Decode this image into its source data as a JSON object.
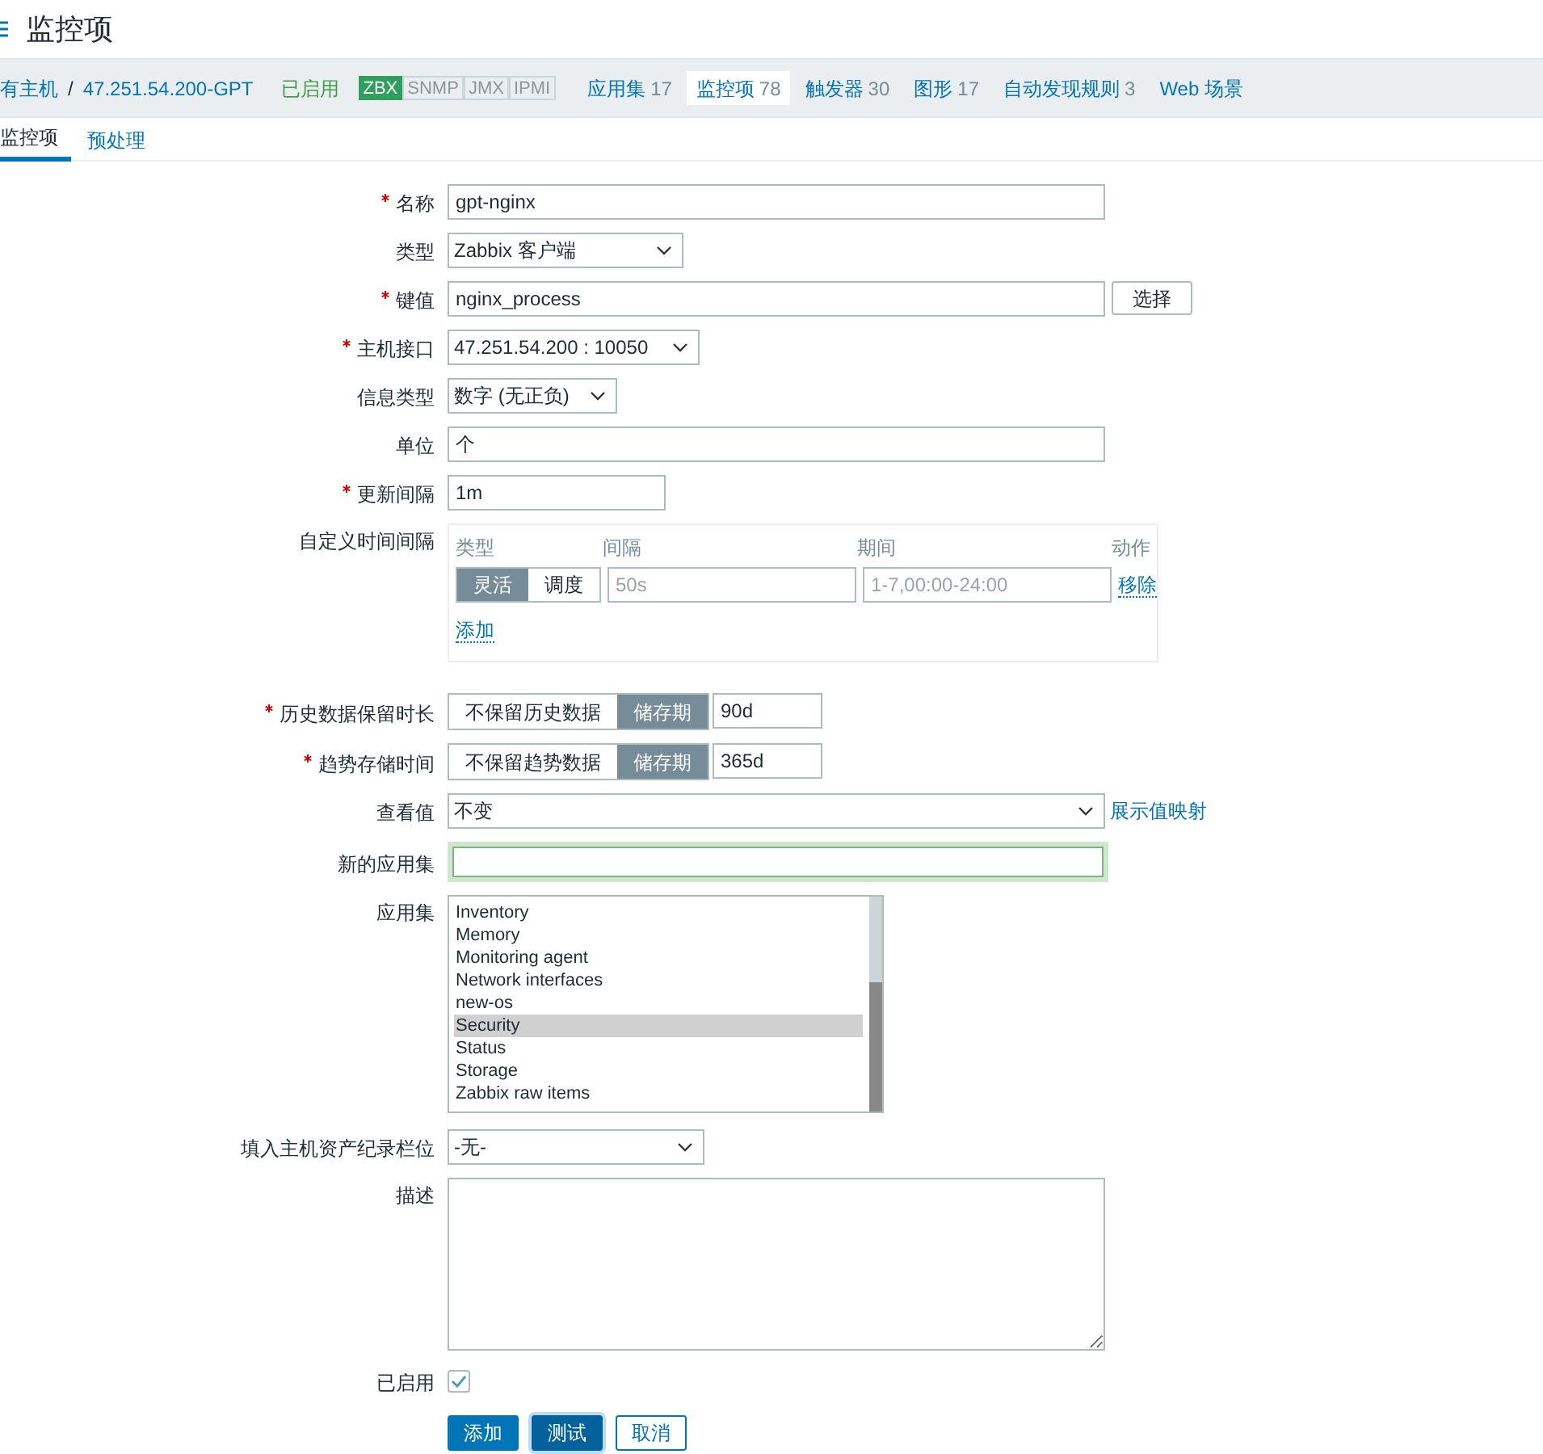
{
  "title": "监控项",
  "nav": {
    "hosts": "有主机",
    "separator": "/",
    "host": "47.251.54.200-GPT",
    "status": "已启用",
    "badges": [
      {
        "label": "ZBX",
        "on": true
      },
      {
        "label": "SNMP",
        "on": false
      },
      {
        "label": "JMX",
        "on": false
      },
      {
        "label": "IPMI",
        "on": false
      }
    ],
    "links": [
      {
        "label": "应用集",
        "count": "17",
        "selected": false
      },
      {
        "label": "监控项",
        "count": "78",
        "selected": true
      },
      {
        "label": "触发器",
        "count": "30",
        "selected": false
      },
      {
        "label": "图形",
        "count": "17",
        "selected": false
      },
      {
        "label": "自动发现规则",
        "count": "3",
        "selected": false
      },
      {
        "label": "Web 场景",
        "selected": false
      }
    ]
  },
  "tabs": [
    {
      "label": "监控项",
      "selected": true
    },
    {
      "label": "预处理",
      "selected": false
    }
  ],
  "form": [
    {
      "kind": "text",
      "label": "名称",
      "required": true,
      "value": "gpt-nginx"
    },
    {
      "kind": "select",
      "label": "类型",
      "required": false,
      "value": "Zabbix 客户端"
    },
    {
      "kind": "text_button",
      "label": "键值",
      "required": true,
      "value": "nginx_process",
      "button": "选择"
    },
    {
      "kind": "select",
      "label": "主机接口",
      "required": true,
      "value": "47.251.54.200 : 10050"
    },
    {
      "kind": "select",
      "label": "信息类型",
      "required": false,
      "value": "数字 (无正负)"
    },
    {
      "kind": "text",
      "label": "单位",
      "required": false,
      "value": "个"
    },
    {
      "kind": "text",
      "label": "更新间隔",
      "required": true,
      "value": "1m"
    },
    {
      "kind": "intervals",
      "label": "自定义时间间隔",
      "required": false,
      "columns": [
        "类型",
        "间隔",
        "期间",
        "动作"
      ],
      "rows": [
        {
          "modes": [
            {
              "label": "灵活",
              "selected": true
            },
            {
              "label": "调度",
              "selected": false
            }
          ],
          "interval_placeholder": "50s",
          "period_placeholder": "1-7,00:00-24:00",
          "action": "移除"
        }
      ],
      "add": "添加"
    },
    {
      "kind": "segmented",
      "label": "历史数据保留时长",
      "required": true,
      "options": [
        {
          "label": "不保留历史数据",
          "selected": false
        },
        {
          "label": "储存期",
          "selected": true
        }
      ],
      "value": "90d"
    },
    {
      "kind": "segmented",
      "label": "趋势存储时间",
      "required": true,
      "options": [
        {
          "label": "不保留趋势数据",
          "selected": false
        },
        {
          "label": "储存期",
          "selected": true
        }
      ],
      "value": "365d"
    },
    {
      "kind": "select_link",
      "label": "查看值",
      "required": false,
      "value": "不变",
      "link": "展示值映射"
    },
    {
      "kind": "focused_text",
      "label": "新的应用集",
      "required": false
    },
    {
      "kind": "listbox",
      "label": "应用集",
      "required": false,
      "items": [
        {
          "label": "Inventory",
          "selected": false
        },
        {
          "label": "Memory",
          "selected": false
        },
        {
          "label": "Monitoring agent",
          "selected": false
        },
        {
          "label": "Network interfaces",
          "selected": false
        },
        {
          "label": "new-os",
          "selected": false
        },
        {
          "label": "Security",
          "selected": true
        },
        {
          "label": "Status",
          "selected": false
        },
        {
          "label": "Storage",
          "selected": false
        },
        {
          "label": "Zabbix raw items",
          "selected": false
        }
      ]
    },
    {
      "kind": "select",
      "label": "填入主机资产纪录栏位",
      "required": false,
      "value": "-无-"
    },
    {
      "kind": "textarea",
      "label": "描述",
      "required": false
    },
    {
      "kind": "checkbox",
      "label": "已启用",
      "required": false,
      "checked": true
    }
  ],
  "buttons": [
    {
      "label": "添加",
      "kind": "primary"
    },
    {
      "label": "测试",
      "kind": "focused"
    },
    {
      "label": "取消",
      "kind": "secondary"
    }
  ]
}
